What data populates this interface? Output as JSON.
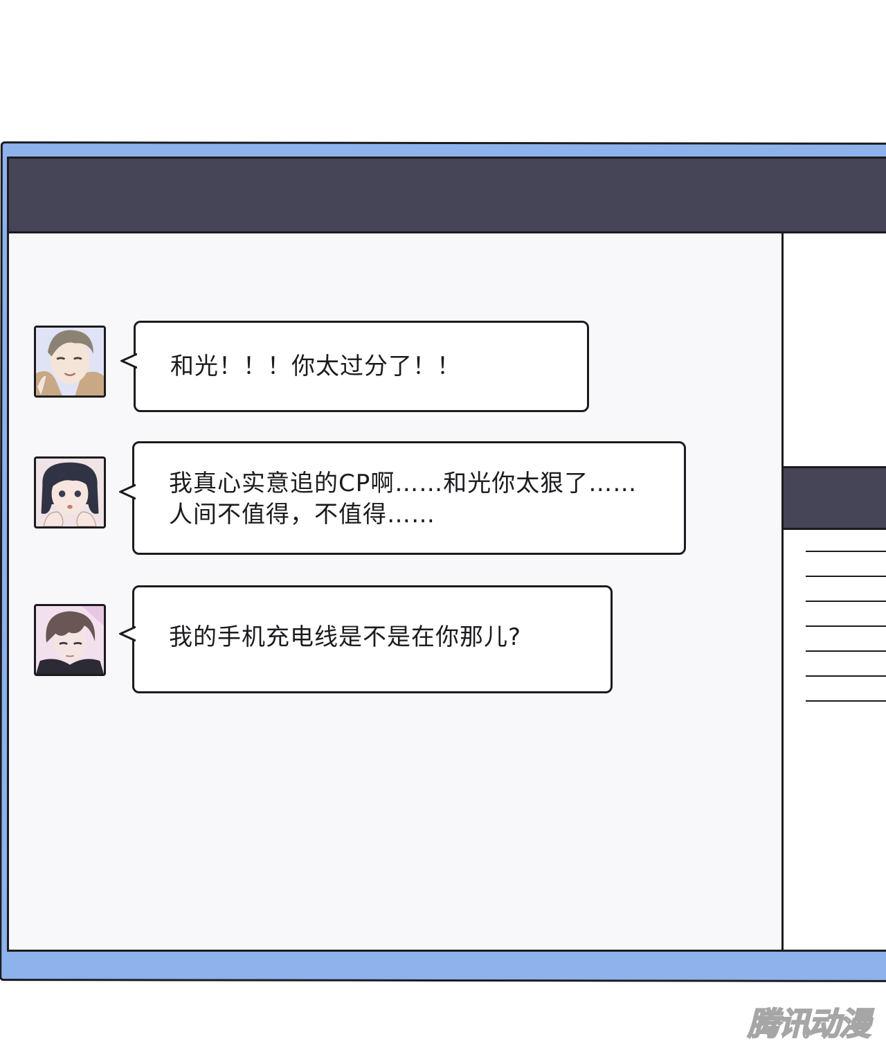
{
  "messages": [
    {
      "sender_avatar": "avatar-male-short-hair",
      "text_lines": [
        "和光！！！你太过分了！！"
      ]
    },
    {
      "sender_avatar": "avatar-female-bob-hair",
      "text_lines": [
        "我真心实意追的CP啊……和光你太狠了……",
        "人间不值得，不值得……"
      ]
    },
    {
      "sender_avatar": "avatar-male-long-bangs",
      "text_lines": [
        "我的手机充电线是不是在你那儿?"
      ]
    }
  ],
  "watermark": {
    "text": "腾讯动漫"
  },
  "colors": {
    "frame": "#8db2ec",
    "title_bar": "#464457",
    "chat_background": "#f8f8fa",
    "outline": "#1b1b1f"
  }
}
